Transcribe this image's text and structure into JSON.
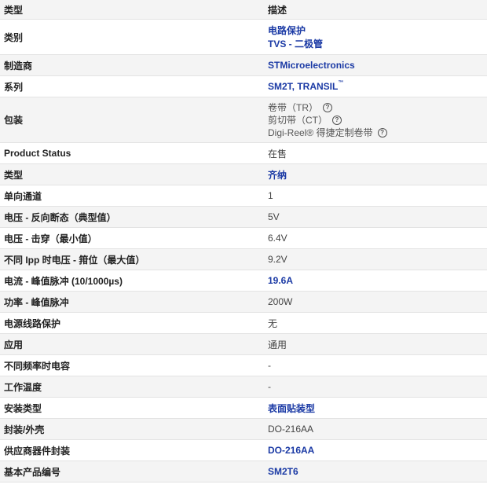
{
  "header": {
    "type_label": "类型",
    "desc_label": "描述"
  },
  "rows": {
    "category": {
      "label": "类别",
      "line1": "电路保护",
      "line2": "TVS - 二极管"
    },
    "manufacturer": {
      "label": "制造商",
      "value": "STMicroelectronics"
    },
    "series": {
      "label": "系列",
      "value": "SM2T, TRANSIL",
      "tm": "™"
    },
    "packaging": {
      "label": "包装",
      "options": [
        "卷带（TR）",
        "剪切带（CT）",
        "Digi-Reel® 得捷定制卷带"
      ],
      "help_glyph": "?"
    },
    "product_status": {
      "label": "Product Status",
      "value": "在售"
    },
    "type": {
      "label": "类型",
      "value": "齐纳"
    },
    "unidirectional_channels": {
      "label": "单向通道",
      "value": "1"
    },
    "reverse_standoff": {
      "label": "电压 - 反向断态（典型值）",
      "value": "5V"
    },
    "breakdown": {
      "label": "电压 - 击穿（最小值）",
      "value": "6.4V"
    },
    "clamping": {
      "label": "不同 Ipp 时电压 - 箝位（最大值）",
      "value": "9.2V"
    },
    "peak_pulse_current": {
      "label": "电流 - 峰值脉冲 (10/1000µs)",
      "value": "19.6A"
    },
    "peak_pulse_power": {
      "label": "功率 - 峰值脉冲",
      "value": "200W"
    },
    "power_line_protection": {
      "label": "电源线路保护",
      "value": "无"
    },
    "application": {
      "label": "应用",
      "value": "通用"
    },
    "capacitance": {
      "label": "不同频率时电容",
      "value": "-"
    },
    "operating_temp": {
      "label": "工作温度",
      "value": "-"
    },
    "mounting_type": {
      "label": "安装类型",
      "value": "表面贴装型"
    },
    "package_case": {
      "label": "封装/外壳",
      "value": "DO-216AA"
    },
    "supplier_package": {
      "label": "供应商器件封装",
      "value": "DO-216AA"
    },
    "base_part_number": {
      "label": "基本产品编号",
      "value": "SM2T6"
    }
  }
}
